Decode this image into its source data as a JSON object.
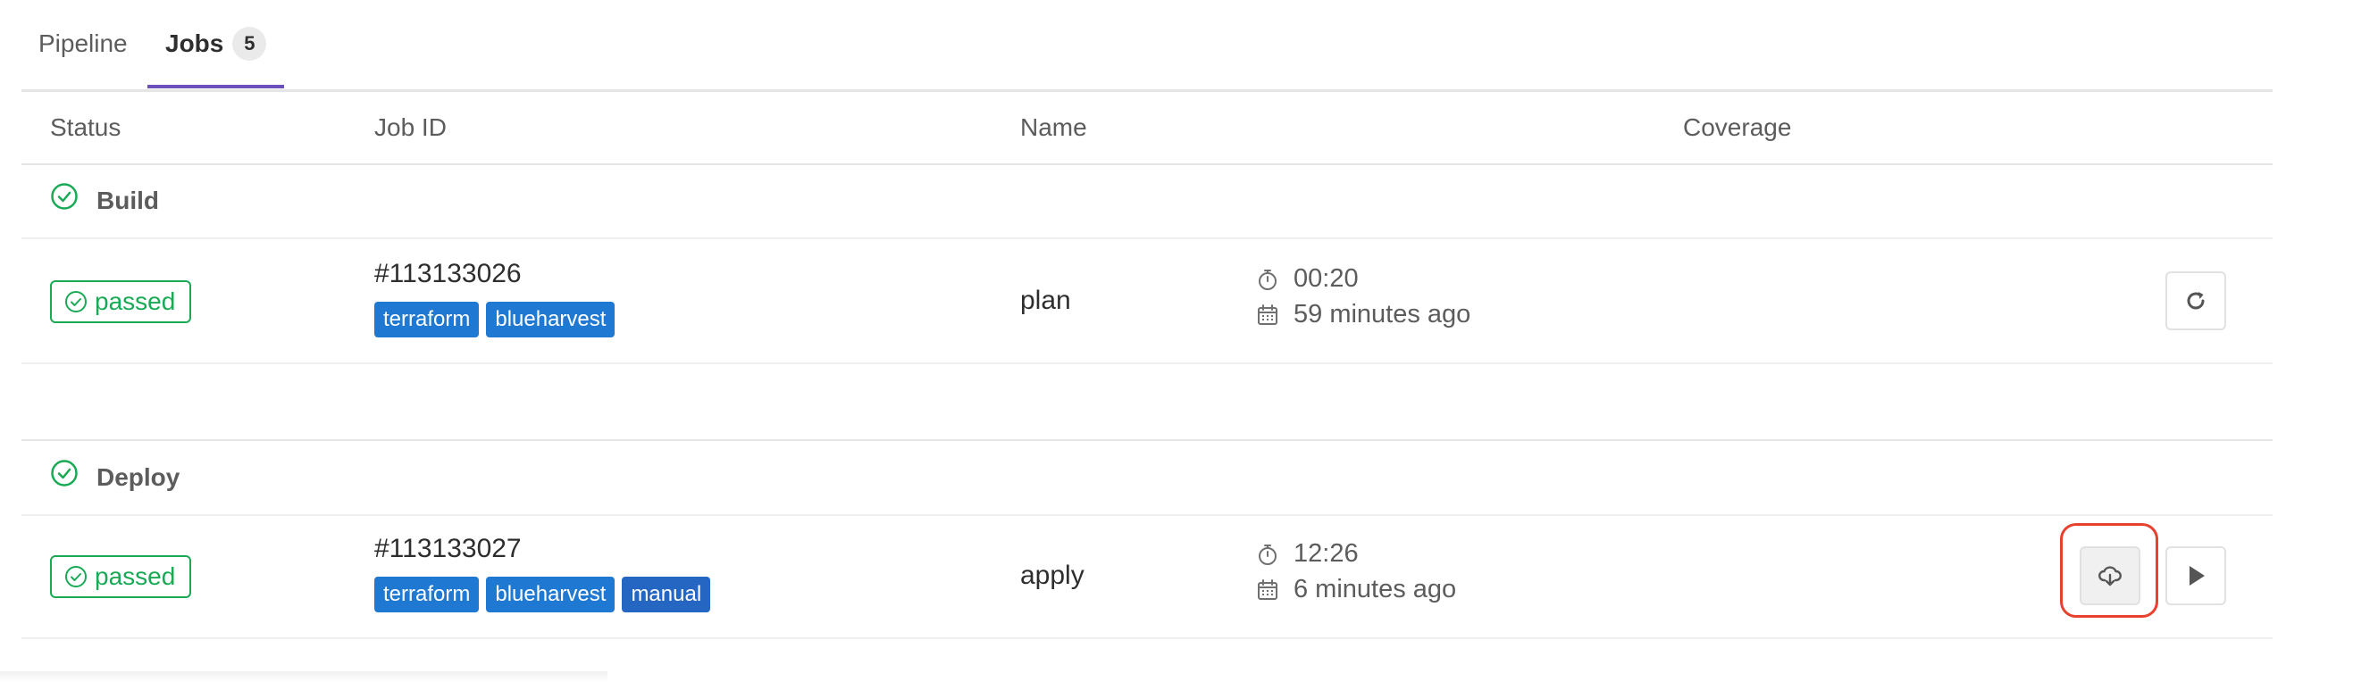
{
  "tabs": [
    {
      "label": "Pipeline"
    },
    {
      "label": "Jobs",
      "count": "5"
    }
  ],
  "table_headers": {
    "status": "Status",
    "job_id": "Job ID",
    "name": "Name",
    "coverage": "Coverage"
  },
  "stages": [
    {
      "name": "Build",
      "jobs": [
        {
          "status": "passed",
          "id": "#113133026",
          "tags": [
            "terraform",
            "blueharvest"
          ],
          "name": "plan",
          "duration": "00:20",
          "finished": "59 minutes ago",
          "actions": [
            "retry-icon"
          ]
        }
      ]
    },
    {
      "name": "Deploy",
      "jobs": [
        {
          "status": "passed",
          "id": "#113133027",
          "tags": [
            "terraform",
            "blueharvest",
            "manual"
          ],
          "name": "apply",
          "duration": "12:26",
          "finished": "6 minutes ago",
          "actions": [
            "cloud-download-icon",
            "play-icon"
          ]
        }
      ]
    }
  ],
  "colors": {
    "success": "#1aaa55",
    "tag": "#1f78d1",
    "active_tab": "#6b4fbb",
    "highlight": "#e8412f"
  }
}
